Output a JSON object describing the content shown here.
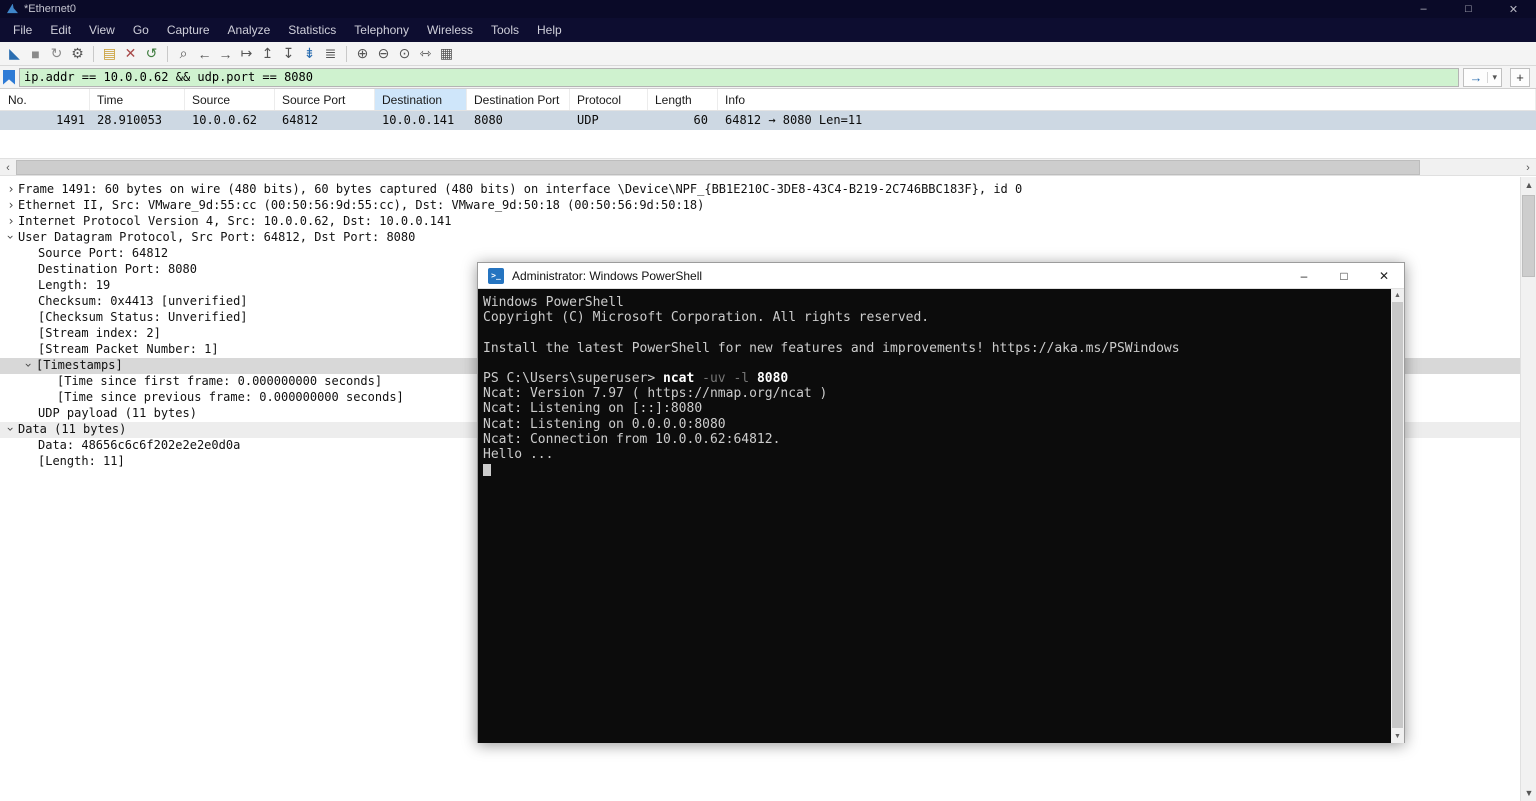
{
  "window": {
    "title": "*Ethernet0"
  },
  "window_controls": {
    "minimize": "–",
    "maximize": "□",
    "close": "✕"
  },
  "menu": {
    "items": [
      "File",
      "Edit",
      "View",
      "Go",
      "Capture",
      "Analyze",
      "Statistics",
      "Telephony",
      "Wireless",
      "Tools",
      "Help"
    ]
  },
  "toolbar": {
    "icons": [
      {
        "name": "start-capture-icon",
        "glyph": "◣"
      },
      {
        "name": "stop-capture-icon",
        "glyph": "■"
      },
      {
        "name": "restart-capture-icon",
        "glyph": "↻"
      },
      {
        "name": "capture-options-icon",
        "glyph": "⚙"
      },
      {
        "name": "open-file-icon",
        "glyph": "▤"
      },
      {
        "name": "close-file-icon",
        "glyph": "✕"
      },
      {
        "name": "reload-file-icon",
        "glyph": "↺"
      },
      {
        "name": "find-packet-icon",
        "glyph": "⌕"
      },
      {
        "name": "go-back-icon",
        "glyph": "←"
      },
      {
        "name": "go-forward-icon",
        "glyph": "→"
      },
      {
        "name": "go-to-packet-icon",
        "glyph": "↦"
      },
      {
        "name": "go-to-first-icon",
        "glyph": "↥"
      },
      {
        "name": "go-to-last-icon",
        "glyph": "↧"
      },
      {
        "name": "autoscroll-icon",
        "glyph": "⇟"
      },
      {
        "name": "colorize-icon",
        "glyph": "≣"
      },
      {
        "name": "zoom-in-icon",
        "glyph": "⊕"
      },
      {
        "name": "zoom-out-icon",
        "glyph": "⊖"
      },
      {
        "name": "zoom-original-icon",
        "glyph": "⊙"
      },
      {
        "name": "resize-columns-icon",
        "glyph": "⇿"
      },
      {
        "name": "capture-file-properties-icon",
        "glyph": "▦"
      }
    ]
  },
  "filter": {
    "value": "ip.addr == 10.0.0.62 && udp.port == 8080",
    "apply_glyph": "→",
    "dropdown_glyph": "▾",
    "add_glyph": "+"
  },
  "packet_list": {
    "columns": [
      "No.",
      "Time",
      "Source",
      "Source Port",
      "Destination",
      "Destination Port",
      "Protocol",
      "Length",
      "Info"
    ],
    "row": {
      "no": "1491",
      "time": "28.910053",
      "source": "10.0.0.62",
      "source_port": "64812",
      "destination": "10.0.0.141",
      "destination_port": "8080",
      "protocol": "UDP",
      "length": "60",
      "info": "64812 → 8080 Len=11"
    }
  },
  "details": {
    "rows": [
      {
        "text": "Frame 1491: 60 bytes on wire (480 bits), 60 bytes captured (480 bits) on interface \\Device\\NPF_{BB1E210C-3DE8-43C4-B219-2C746BBC183F}, id 0"
      },
      {
        "text": "Ethernet II, Src: VMware_9d:55:cc (00:50:56:9d:55:cc), Dst: VMware_9d:50:18 (00:50:56:9d:50:18)"
      },
      {
        "text": "Internet Protocol Version 4, Src: 10.0.0.62, Dst: 10.0.0.141"
      },
      {
        "text": "User Datagram Protocol, Src Port: 64812, Dst Port: 8080"
      },
      {
        "text": "Source Port: 64812"
      },
      {
        "text": "Destination Port: 8080"
      },
      {
        "text": "Length: 19"
      },
      {
        "text": "Checksum: 0x4413 [unverified]"
      },
      {
        "text": "[Checksum Status: Unverified]"
      },
      {
        "text": "[Stream index: 2]"
      },
      {
        "text": "[Stream Packet Number: 1]"
      },
      {
        "text": "[Timestamps]"
      },
      {
        "text": "[Time since first frame: 0.000000000 seconds]"
      },
      {
        "text": "[Time since previous frame: 0.000000000 seconds]"
      },
      {
        "text": "UDP payload (11 bytes)"
      },
      {
        "text": "Data (11 bytes)"
      },
      {
        "text": "Data: 48656c6c6f202e2e2e0d0a"
      },
      {
        "text": "[Length: 11]"
      }
    ]
  },
  "powershell": {
    "title": "Administrator: Windows PowerShell",
    "lines_top": [
      "Windows PowerShell",
      "Copyright (C) Microsoft Corporation. All rights reserved.",
      "",
      "Install the latest PowerShell for new features and improvements! https://aka.ms/PSWindows",
      ""
    ],
    "prompt": "PS C:\\Users\\superuser> ",
    "command": "ncat",
    "args": " -uv -l ",
    "port": "8080",
    "lines_bottom": [
      "Ncat: Version 7.97 ( https://nmap.org/ncat )",
      "Ncat: Listening on [::]:8080",
      "Ncat: Listening on 0.0.0.0:8080",
      "Ncat: Connection from 10.0.0.62:64812.",
      "Hello ..."
    ],
    "icon_glyph": ">_"
  },
  "colors": {
    "titlebar": "#0a0a28",
    "menubar": "#0d0d30",
    "filter_valid_bg": "#cff2cf",
    "sorted_column_bg": "#cfe6fa",
    "selected_packet_bg": "#cdd8e3",
    "selected_detail_bg": "#d8d8d8",
    "detail_stripe_bg": "#ededed",
    "terminal_bg": "#0c0c0c",
    "terminal_fg": "#cccccc",
    "accent_blue": "#2a6db0"
  }
}
